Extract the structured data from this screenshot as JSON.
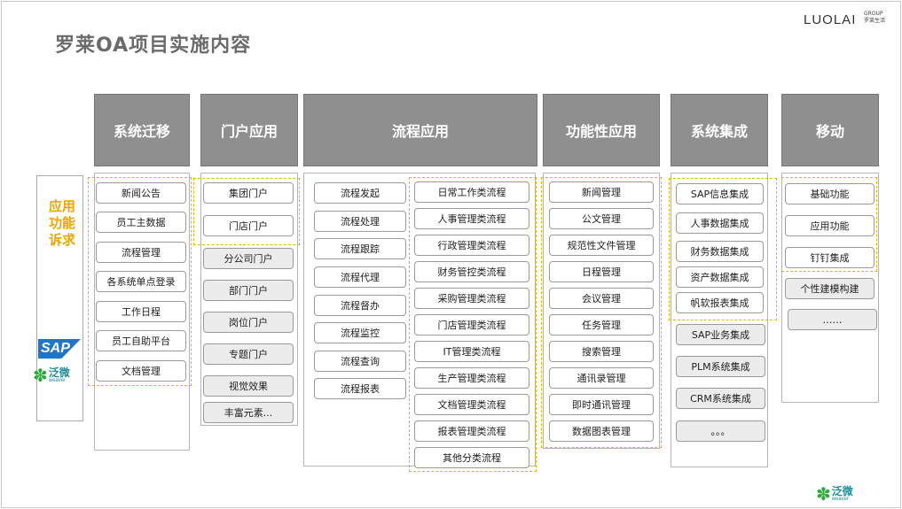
{
  "title": "罗莱OA项目实施内容",
  "logo": {
    "name": "LUOLAI",
    "group": "GROUP",
    "sub": "罗莱生活"
  },
  "side": {
    "label": "应用功能诉求",
    "sap": "SAP",
    "weaver_cn": "泛微",
    "weaver_en": "weaver"
  },
  "columns": {
    "migration": {
      "header": "系统迁移",
      "items": [
        "新闻公告",
        "员工主数据",
        "流程管理",
        "各系统单点登录",
        "工作日程",
        "员工自助平台",
        "文档管理"
      ]
    },
    "portal": {
      "header": "门户应用",
      "items": [
        "集团门户",
        "门店门户"
      ],
      "items_other": [
        "分公司门户",
        "部门门户",
        "岗位门户",
        "专题门户",
        "视觉效果",
        "丰富元素..."
      ]
    },
    "workflow": {
      "header": "流程应用",
      "left": [
        "流程发起",
        "流程处理",
        "流程跟踪",
        "流程代理",
        "流程督办",
        "流程监控",
        "流程查询",
        "流程报表"
      ],
      "right": [
        "日常工作类流程",
        "人事管理类流程",
        "行政管理类流程",
        "财务管控类流程",
        "采购管理类流程",
        "门店管理类流程",
        "IT管理类流程",
        "生产管理类流程",
        "文档管理类流程",
        "报表管理类流程",
        "其他分类流程"
      ]
    },
    "functional": {
      "header": "功能性应用",
      "items": [
        "新闻管理",
        "公文管理",
        "规范性文件管理",
        "日程管理",
        "会议管理",
        "任务管理",
        "搜索管理",
        "通讯录管理",
        "即时通讯管理",
        "数据图表管理"
      ]
    },
    "integration": {
      "header": "系统集成",
      "items": [
        "SAP信息集成",
        "人事数据集成",
        "财务数据集成",
        "资产数据集成",
        "帆软报表集成"
      ],
      "items_other": [
        "SAP业务集成",
        "PLM系统集成",
        "CRM系统集成",
        "。。。"
      ]
    },
    "mobile": {
      "header": "移动",
      "items": [
        "基础功能",
        "应用功能",
        "钉钉集成"
      ],
      "items_other": [
        "个性建模构建",
        "……"
      ]
    }
  },
  "footer_logo": {
    "cn": "泛微",
    "en": "weaver"
  }
}
